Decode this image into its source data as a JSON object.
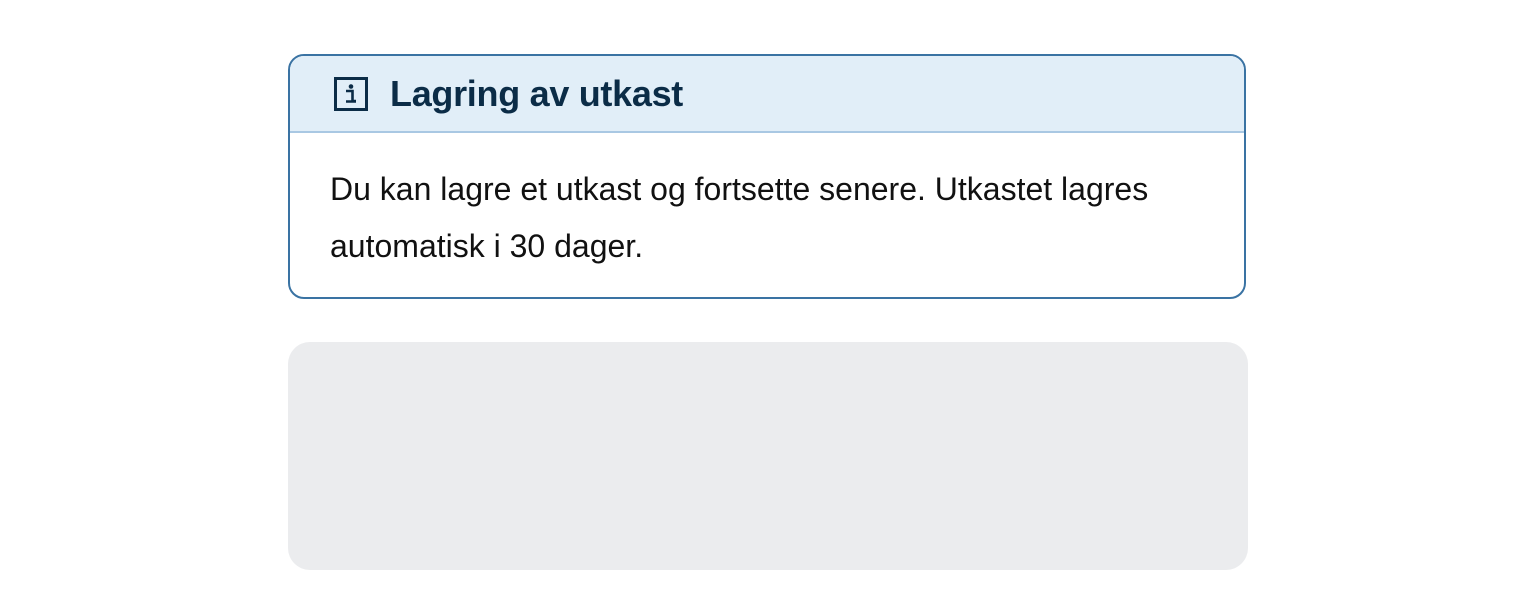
{
  "info_panel": {
    "icon": "info-icon",
    "title": "Lagring av utkast",
    "body": "Du kan lagre et utkast og fortsette senere. Utkastet lagres automatisk i 30 dager."
  },
  "colors": {
    "panel_border": "#3a73a3",
    "header_background": "#e1eef8",
    "title_color": "#0b2c47",
    "placeholder_background": "#ebecee"
  }
}
